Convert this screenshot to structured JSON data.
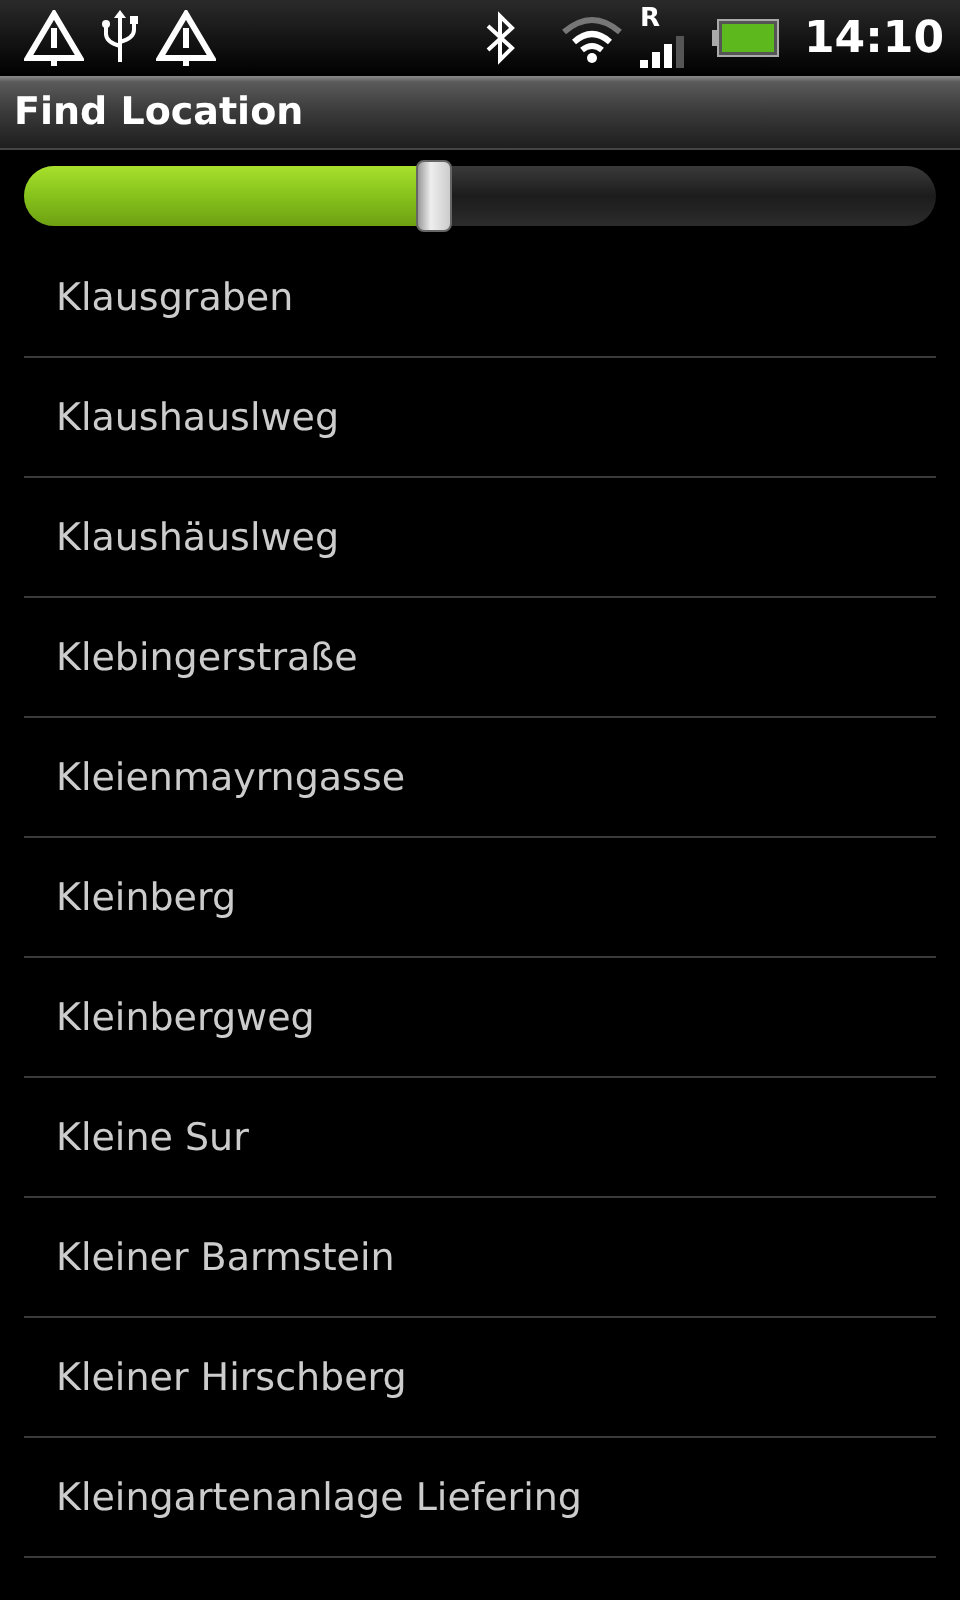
{
  "status_bar": {
    "roaming": "R",
    "time": "14:10"
  },
  "title": "Find Location",
  "slider": {
    "level": 0.45
  },
  "items": [
    "Klausgraben",
    "Klaushauslweg",
    "Klaushäuslweg",
    "Klebingerstraße",
    "Kleienmayrngasse",
    "Kleinberg",
    "Kleinbergweg",
    "Kleine Sur",
    "Kleiner Barmstein",
    "Kleiner Hirschberg",
    "Kleingartenanlage Liefering"
  ]
}
